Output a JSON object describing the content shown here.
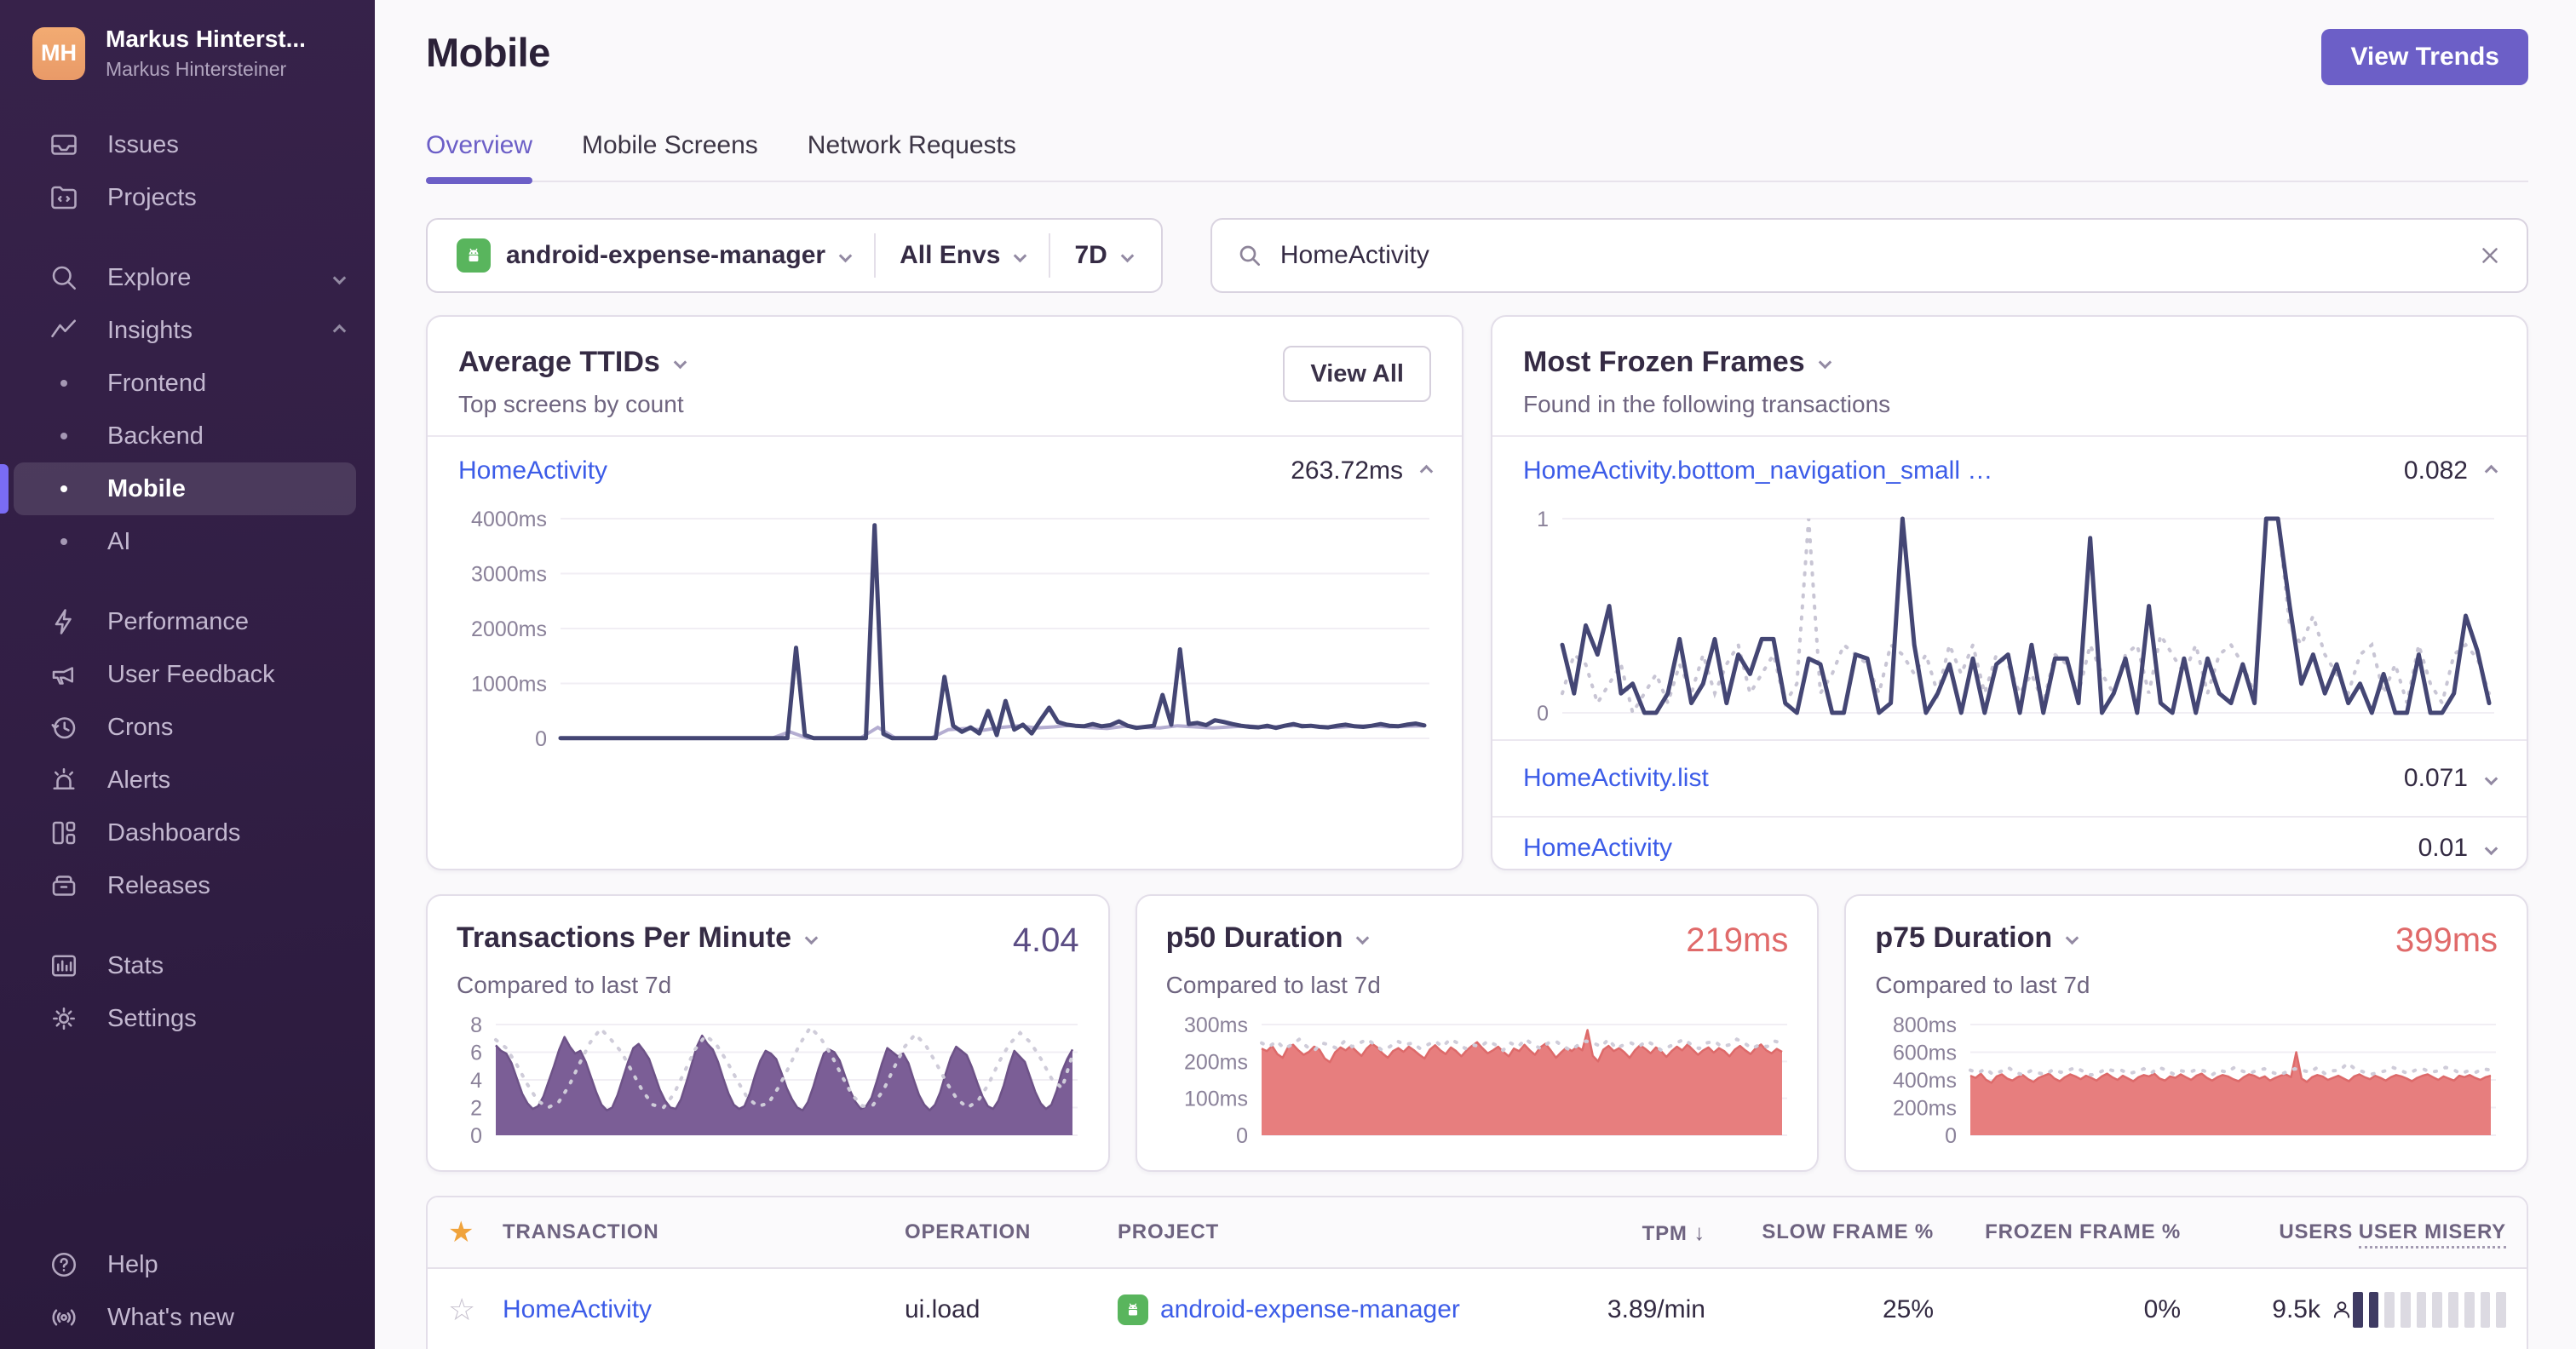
{
  "sidebar": {
    "org_name": "Markus Hinterst...",
    "org_subtitle": "Markus Hintersteiner",
    "avatar_initials": "MH",
    "items": [
      {
        "label": "Issues"
      },
      {
        "label": "Projects"
      },
      {
        "label": "Explore"
      },
      {
        "label": "Insights"
      },
      {
        "label": "Frontend"
      },
      {
        "label": "Backend"
      },
      {
        "label": "Mobile"
      },
      {
        "label": "AI"
      },
      {
        "label": "Performance"
      },
      {
        "label": "User Feedback"
      },
      {
        "label": "Crons"
      },
      {
        "label": "Alerts"
      },
      {
        "label": "Dashboards"
      },
      {
        "label": "Releases"
      },
      {
        "label": "Stats"
      },
      {
        "label": "Settings"
      },
      {
        "label": "Help"
      },
      {
        "label": "What's new"
      }
    ]
  },
  "header": {
    "title": "Mobile",
    "view_trends_label": "View Trends",
    "tabs": [
      {
        "label": "Overview",
        "active": true
      },
      {
        "label": "Mobile Screens",
        "active": false
      },
      {
        "label": "Network Requests",
        "active": false
      }
    ]
  },
  "filters": {
    "project": "android-expense-manager",
    "environment": "All Envs",
    "date_range": "7D",
    "search_value": "HomeActivity"
  },
  "cards": {
    "avg_ttid": {
      "title": "Average TTIDs",
      "subtitle": "Top screens by count",
      "view_all_label": "View All",
      "screen_name": "HomeActivity",
      "screen_value": "263.72ms"
    },
    "frozen": {
      "title": "Most Frozen Frames",
      "subtitle": "Found in the following transactions",
      "rows": [
        {
          "name": "HomeActivity.bottom_navigation_small …",
          "value": "0.082"
        },
        {
          "name": "HomeActivity.list",
          "value": "0.071"
        },
        {
          "name": "HomeActivity",
          "value": "0.01"
        }
      ]
    },
    "tpm": {
      "title": "Transactions Per Minute",
      "value": "4.04",
      "subtitle": "Compared to last 7d"
    },
    "p50": {
      "title": "p50 Duration",
      "value": "219ms",
      "subtitle": "Compared to last 7d"
    },
    "p75": {
      "title": "p75 Duration",
      "value": "399ms",
      "subtitle": "Compared to last 7d"
    }
  },
  "table": {
    "columns": [
      "TRANSACTION",
      "OPERATION",
      "PROJECT",
      "TPM",
      "SLOW FRAME %",
      "FROZEN FRAME %",
      "USERS",
      "USER MISERY"
    ],
    "sort_column": "TPM",
    "row": {
      "transaction": "HomeActivity",
      "operation": "ui.load",
      "project": "android-expense-manager",
      "tpm": "3.89/min",
      "slow_frame": "25%",
      "frozen_frame": "0%",
      "users": "9.5k",
      "misery_total": 10,
      "misery_filled": 2
    }
  },
  "chart_data": {
    "avg_ttid": {
      "type": "line",
      "title": "Average TTID HomeActivity (ms)",
      "ylabel": "ms",
      "ylim": [
        0,
        4000
      ],
      "gutter": 120,
      "ticks": [
        {
          "v": 4000,
          "label": "4000ms"
        },
        {
          "v": 3000,
          "label": "3000ms"
        },
        {
          "v": 2000,
          "label": "2000ms"
        },
        {
          "v": 1000,
          "label": "1000ms"
        },
        {
          "v": 0,
          "label": "0"
        }
      ],
      "color": "#444674",
      "prev_color": "#b4add1",
      "prev_dotted": false,
      "values": [
        5,
        5,
        5,
        5,
        5,
        5,
        5,
        5,
        5,
        5,
        5,
        5,
        5,
        5,
        5,
        5,
        5,
        5,
        5,
        5,
        5,
        5,
        5,
        5,
        5,
        5,
        5,
        1650,
        60,
        5,
        5,
        5,
        5,
        5,
        5,
        5,
        3880,
        80,
        5,
        5,
        5,
        5,
        5,
        5,
        1120,
        230,
        120,
        200,
        90,
        500,
        60,
        680,
        160,
        250,
        90,
        330,
        560,
        300,
        250,
        230,
        220,
        260,
        220,
        240,
        310,
        230,
        190,
        210,
        230,
        790,
        250,
        1620,
        260,
        280,
        240,
        330,
        300,
        260,
        230,
        210,
        200,
        230,
        190,
        230,
        260,
        220,
        230,
        210,
        200,
        230,
        250,
        220,
        210,
        230,
        260,
        230,
        220,
        250,
        270,
        235
      ],
      "prev": [
        5,
        5,
        5,
        5,
        5,
        5,
        5,
        5,
        5,
        5,
        5,
        5,
        5,
        120,
        5,
        5,
        5,
        5,
        200,
        5,
        5,
        5,
        160,
        180,
        150,
        200,
        230,
        190,
        210,
        240,
        200,
        180,
        220,
        200,
        190,
        230,
        210,
        190,
        210,
        230,
        200,
        220,
        240,
        210,
        200,
        220,
        230,
        210,
        220,
        230
      ]
    },
    "frozen_frames": {
      "type": "line",
      "title": "Frozen frames per transaction",
      "ylim": [
        0,
        1
      ],
      "gutter": 46,
      "ticks": [
        {
          "v": 1,
          "label": "1"
        },
        {
          "v": 0,
          "label": "0"
        }
      ],
      "color": "#444674",
      "prev_color": "#c8c5d4",
      "prev_dotted": true,
      "values": [
        0.35,
        0.1,
        0.45,
        0.3,
        0.55,
        0.1,
        0.15,
        0,
        0,
        0.1,
        0.38,
        0.05,
        0.15,
        0.38,
        0.05,
        0.3,
        0.2,
        0.38,
        0.38,
        0.05,
        0,
        0.28,
        0.25,
        0,
        0,
        0.3,
        0.28,
        0,
        0.05,
        1,
        0.35,
        0,
        0.1,
        0.25,
        0,
        0.28,
        0,
        0.25,
        0.3,
        0,
        0.35,
        0,
        0.28,
        0.28,
        0.05,
        0.9,
        0,
        0.1,
        0.28,
        0,
        0.55,
        0.05,
        0,
        0.28,
        0,
        0.28,
        0.1,
        0.05,
        0.25,
        0.05,
        1,
        1,
        0.55,
        0.15,
        0.3,
        0.1,
        0.25,
        0.05,
        0.15,
        0,
        0.2,
        0,
        0,
        0.3,
        0,
        0,
        0.1,
        0.5,
        0.32,
        0.05
      ],
      "prev": [
        0.1,
        0.3,
        0.25,
        0.05,
        0.15,
        0.25,
        0,
        0.1,
        0.2,
        0.05,
        0.25,
        0.1,
        0.3,
        0.1,
        0.25,
        0.35,
        0.1,
        0.2,
        0.3,
        0.05,
        0.15,
        1,
        0.1,
        0.2,
        0.35,
        0.3,
        0.25,
        0.1,
        0.35,
        0.3,
        0.2,
        0.3,
        0.1,
        0.35,
        0.2,
        0.35,
        0.1,
        0.3,
        0.25,
        0.1,
        0.2,
        0.05,
        0.3,
        0.25,
        0.1,
        0.35,
        0.2,
        0.1,
        0.3,
        0.35,
        0.1,
        0.4,
        0.3,
        0.2,
        0.35,
        0.1,
        0.3,
        0.35,
        0.25,
        0.1,
        1,
        1,
        0.45,
        0.35,
        0.5,
        0.3,
        0.2,
        0.1,
        0.3,
        0.35,
        0.1,
        0.25,
        0.05,
        0.35,
        0.15,
        0.05,
        0.3,
        0.35,
        0.28,
        0.1
      ]
    },
    "tpm": {
      "type": "area",
      "title": "Transactions Per Minute",
      "ylim": [
        0,
        8
      ],
      "gutter": 46,
      "ticks": [
        {
          "v": 8,
          "label": "8"
        },
        {
          "v": 6,
          "label": "6"
        },
        {
          "v": 4,
          "label": "4"
        },
        {
          "v": 2,
          "label": "2"
        },
        {
          "v": 0,
          "label": "0"
        }
      ],
      "fill": "#7b5e96",
      "color": "#6d5287",
      "prev_color": "#cfccd9",
      "prev_dotted": true,
      "values": [
        6.5,
        6.1,
        5.9,
        5.2,
        4.1,
        3.0,
        2.3,
        1.9,
        2.1,
        2.8,
        3.9,
        5.0,
        6.2,
        7.1,
        6.4,
        5.9,
        6.1,
        5.3,
        4.2,
        3.1,
        2.2,
        1.8,
        2.0,
        2.9,
        4.1,
        5.3,
        6.3,
        6.6,
        6.1,
        5.5,
        4.4,
        3.3,
        2.5,
        2.0,
        1.9,
        2.6,
        3.8,
        5.1,
        6.4,
        7.2,
        6.6,
        6.2,
        5.3,
        4.1,
        3.0,
        2.2,
        1.9,
        2.1,
        3.0,
        4.3,
        5.4,
        6.1,
        5.9,
        5.5,
        4.5,
        3.4,
        2.6,
        2.0,
        1.8,
        2.4,
        3.5,
        4.8,
        5.9,
        6.2,
        6.0,
        5.4,
        4.3,
        3.2,
        2.4,
        1.9,
        2.1,
        2.7,
        3.9,
        5.2,
        6.3,
        6.0,
        5.7,
        5.9,
        5.2,
        4.0,
        2.9,
        2.2,
        1.8,
        2.2,
        3.1,
        4.4,
        5.6,
        6.4,
        6.1,
        5.8,
        4.9,
        3.8,
        2.8,
        2.1,
        1.9,
        2.5,
        3.6,
        5.0,
        6.1,
        5.7,
        5.3,
        4.2,
        3.1,
        2.3,
        1.9,
        2.2,
        3.2,
        4.6,
        5.5,
        6.2
      ],
      "prev": [
        6.9,
        6.3,
        5.1,
        3.7,
        2.5,
        2.0,
        2.4,
        3.6,
        5.2,
        6.7,
        7.7,
        6.9,
        6.0,
        4.6,
        3.2,
        2.2,
        2.0,
        3.0,
        4.6,
        6.2,
        7.2,
        6.6,
        5.4,
        4.0,
        2.7,
        2.1,
        2.3,
        3.5,
        5.0,
        6.6,
        7.8,
        7.0,
        5.8,
        4.3,
        2.9,
        2.1,
        2.2,
        3.3,
        4.9,
        6.4,
        7.3,
        6.5,
        5.2,
        3.8,
        2.6,
        2.0,
        2.5,
        3.7,
        5.3,
        6.6,
        7.4,
        6.7,
        5.5,
        4.1,
        3.4,
        5.8
      ]
    },
    "p50": {
      "type": "area",
      "title": "p50 Duration (ms)",
      "ylim": [
        0,
        300
      ],
      "gutter": 112,
      "ticks": [
        {
          "v": 300,
          "label": "300ms"
        },
        {
          "v": 200,
          "label": "200ms"
        },
        {
          "v": 100,
          "label": "100ms"
        },
        {
          "v": 0,
          "label": "0"
        }
      ],
      "fill": "#e77e7e",
      "color": "#dd6a6a",
      "prev_color": "#cfccd9",
      "prev_dotted": true,
      "values": [
        235,
        228,
        242,
        220,
        210,
        238,
        245,
        230,
        218,
        226,
        240,
        232,
        208,
        198,
        225,
        238,
        230,
        242,
        228,
        215,
        235,
        248,
        238,
        222,
        210,
        228,
        236,
        226,
        240,
        230,
        218,
        208,
        232,
        244,
        230,
        220,
        238,
        228,
        214,
        230,
        242,
        252,
        236,
        222,
        230,
        240,
        226,
        214,
        235,
        228,
        245,
        230,
        218,
        238,
        248,
        230,
        210,
        225,
        238,
        228,
        240,
        230,
        285,
        215,
        200,
        232,
        242,
        228,
        236,
        225,
        210,
        230,
        244,
        234,
        222,
        238,
        228,
        212,
        228,
        240,
        230,
        246,
        232,
        218,
        230,
        238,
        224,
        236,
        228,
        214,
        232,
        242,
        230,
        220,
        236,
        246,
        230,
        222,
        234,
        226
      ],
      "prev": [
        250,
        240,
        255,
        235,
        245,
        260,
        240,
        230,
        250,
        245,
        235,
        255,
        240,
        250,
        260,
        245,
        230,
        240,
        255,
        245,
        250,
        235,
        245,
        255,
        240,
        260,
        250,
        235,
        245,
        240,
        255,
        245,
        230,
        250,
        240,
        260,
        245,
        235,
        250,
        255,
        240,
        230,
        245,
        255,
        250,
        240,
        260,
        235,
        245,
        250,
        240,
        255,
        245,
        230,
        240,
        250,
        260,
        245,
        235,
        250,
        255,
        240,
        245,
        260,
        250,
        235,
        245,
        240,
        255,
        250
      ]
    },
    "p75": {
      "type": "area",
      "title": "p75 Duration (ms)",
      "ylim": [
        0,
        800
      ],
      "gutter": 112,
      "ticks": [
        {
          "v": 800,
          "label": "800ms"
        },
        {
          "v": 600,
          "label": "600ms"
        },
        {
          "v": 400,
          "label": "400ms"
        },
        {
          "v": 200,
          "label": "200ms"
        },
        {
          "v": 0,
          "label": "0"
        }
      ],
      "fill": "#e77e7e",
      "color": "#dd6a6a",
      "prev_color": "#cfccd9",
      "prev_dotted": true,
      "values": [
        430,
        415,
        445,
        400,
        380,
        425,
        440,
        410,
        395,
        420,
        435,
        405,
        385,
        415,
        430,
        445,
        410,
        390,
        420,
        440,
        425,
        405,
        430,
        415,
        395,
        425,
        445,
        420,
        400,
        430,
        410,
        390,
        420,
        435,
        425,
        445,
        410,
        395,
        425,
        415,
        440,
        420,
        400,
        430,
        445,
        415,
        395,
        420,
        435,
        425,
        405,
        390,
        420,
        440,
        430,
        410,
        425,
        395,
        415,
        430,
        440,
        420,
        600,
        410,
        385,
        420,
        435,
        425,
        400,
        415,
        430,
        410,
        390,
        425,
        440,
        420,
        405,
        430,
        415,
        395,
        420,
        435,
        425,
        410,
        390,
        415,
        430,
        440,
        420,
        400,
        425,
        410,
        395,
        430,
        420,
        435,
        415,
        400,
        420,
        430
      ],
      "prev": [
        470,
        450,
        480,
        440,
        460,
        490,
        455,
        435,
        465,
        450,
        440,
        475,
        455,
        470,
        490,
        460,
        435,
        450,
        480,
        465,
        470,
        445,
        460,
        480,
        450,
        490,
        470,
        440,
        465,
        455,
        475,
        465,
        435,
        470,
        455,
        490,
        465,
        445,
        470,
        480,
        455,
        435,
        460,
        480,
        470,
        455,
        490,
        445,
        465,
        470,
        520,
        480,
        460,
        440,
        450,
        465,
        490,
        470,
        445,
        470,
        480,
        455,
        465,
        490,
        475,
        445,
        465,
        455,
        480,
        470
      ]
    }
  },
  "theme": {
    "accent": "#6C5FC7",
    "link_blue": "#3c5ce8",
    "chart_purple_line": "#444674",
    "chart_purple_fill": "#7b5e96",
    "chart_red_fill": "#e77e7e",
    "sidebar_bg": "#311e44",
    "star_orange": "#f0a33c"
  }
}
